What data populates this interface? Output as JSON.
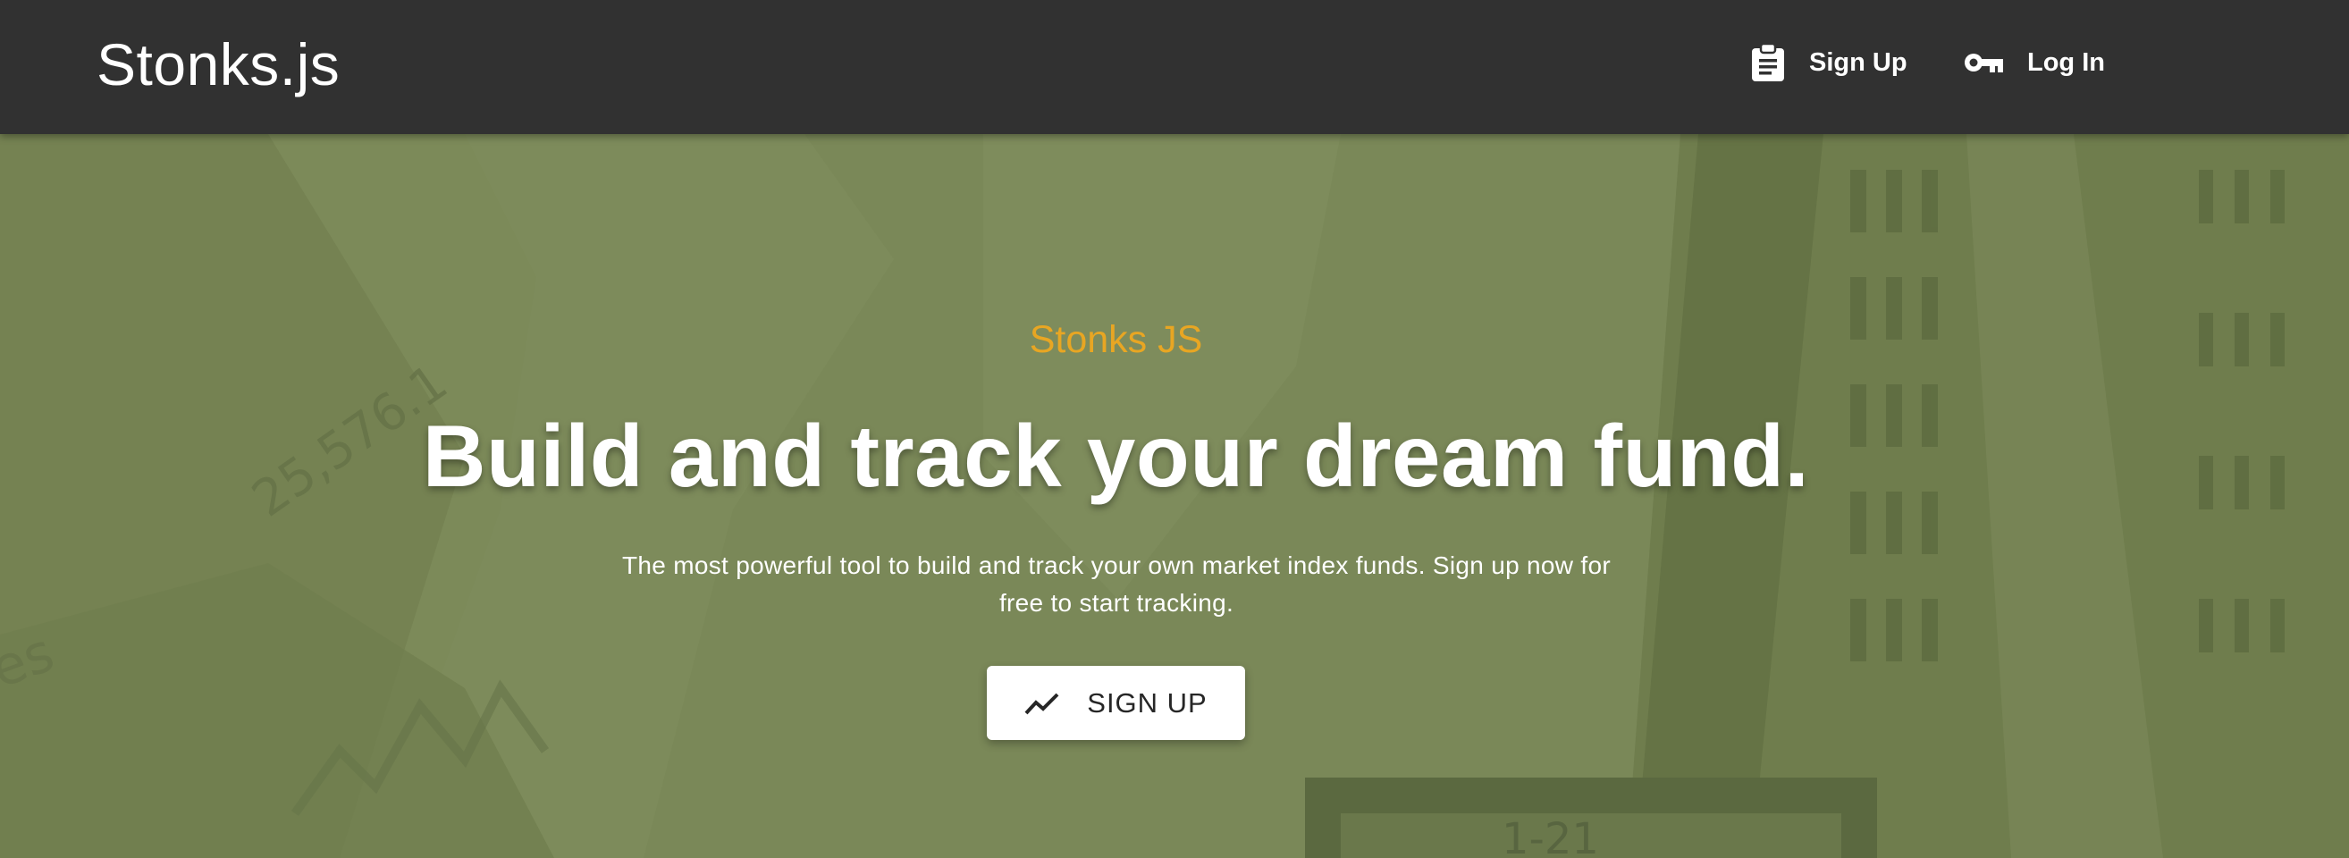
{
  "navbar": {
    "brand": "Stonks.js",
    "links": [
      {
        "label": "Sign Up",
        "icon": "clipboard-icon"
      },
      {
        "label": "Log In",
        "icon": "key-icon"
      }
    ]
  },
  "hero": {
    "eyebrow": "Stonks JS",
    "headline": "Build and track your dream fund.",
    "subtext_line1": "The most powerful tool to build and track your own market index funds. Sign up now for",
    "subtext_line2": "free to start tracking.",
    "cta": {
      "label": "SIGN UP",
      "icon": "trending-up-icon"
    },
    "background_image": {
      "depicts": "stock market background with building and ticker numbers",
      "visible_text": [
        "25,576.1",
        "1-21",
        "es"
      ]
    }
  },
  "colors": {
    "navbar_bg": "#313131",
    "hero_bg": "#7a8858",
    "accent": "#e8a623",
    "text_light": "#ffffff"
  }
}
